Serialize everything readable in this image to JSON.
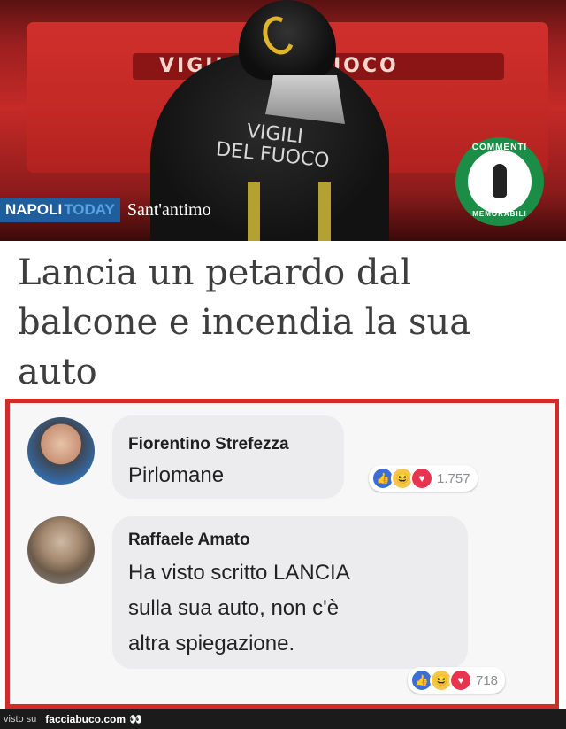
{
  "hero": {
    "truck_text": "VIGILI DEL FUOCO",
    "vest_line1": "VIGILI",
    "vest_line2": "DEL FUOCO",
    "source_name_part1": "NAPOLI",
    "source_name_part2": "TODAY",
    "location": "Sant'antimo",
    "badge_top": "COMMENTI",
    "badge_bottom": "MEMORABILI",
    "colors": {
      "truck_red": "#c52a27",
      "badge_green": "#1c8d46",
      "napoli_blue": "#1f5e9c"
    }
  },
  "article": {
    "headline": "Lancia un petardo dal balcone e incendia la sua auto"
  },
  "comments": [
    {
      "author": "Fiorentino Strefezza",
      "text": "Pirlomane",
      "reaction_icons": [
        "like-icon",
        "haha-icon",
        "love-icon"
      ],
      "reaction_count": "1.757"
    },
    {
      "author": "Raffaele Amato",
      "text_line1": "Ha visto scritto LANCIA",
      "text_line2": "sulla sua auto, non c'è",
      "text_line3": "altra spiegazione.",
      "reaction_icons": [
        "like-icon",
        "haha-icon",
        "love-icon"
      ],
      "reaction_count": "718"
    }
  ],
  "footer": {
    "prefix": "visto su",
    "site": "facciabuco.com",
    "eyes": "👀"
  },
  "colors": {
    "frame_red": "#d12b2b",
    "bubble_gray": "#ececef"
  }
}
